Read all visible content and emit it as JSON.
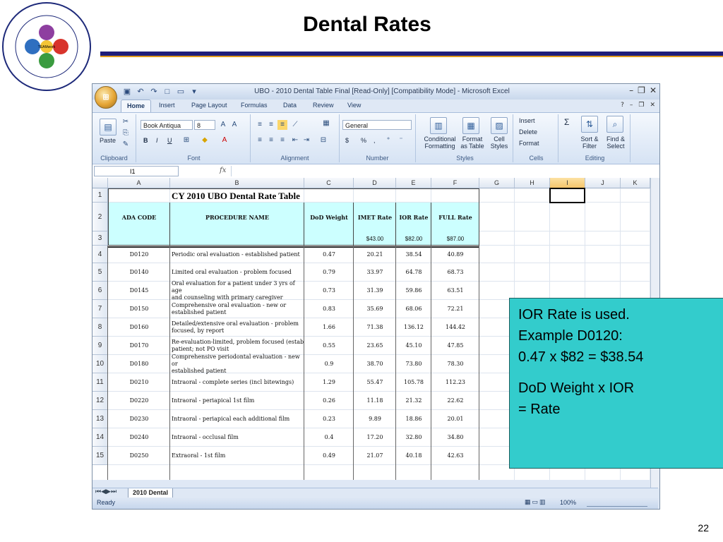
{
  "slide": {
    "title": "Dental Rates",
    "page_number": "22",
    "logo": {
      "ring_text": "2011 MHS REVENUE CYCLE EDUCATIONAL CONFERENCE",
      "bottom_text": "Together Everyone Achieves More",
      "labels": [
        "UBO",
        "TEAMwork",
        "UBU",
        "DQ",
        "MEPRS"
      ]
    }
  },
  "excel": {
    "window_title": "UBO - 2010 Dental Table Final  [Read-Only]  [Compatibility Mode] - Microsoft Excel",
    "tabs": [
      "Home",
      "Insert",
      "Page Layout",
      "Formulas",
      "Data",
      "Review",
      "View"
    ],
    "ribbon": {
      "clipboard": {
        "label": "Clipboard",
        "paste": "Paste"
      },
      "font": {
        "label": "Font",
        "family": "Book Antiqua",
        "size": "8",
        "bold": "B",
        "italic": "I",
        "underline": "U"
      },
      "alignment": {
        "label": "Alignment"
      },
      "number": {
        "label": "Number",
        "format": "General",
        "currency": "$",
        "percent": "%",
        "comma": ","
      },
      "styles": {
        "label": "Styles",
        "conditional": "Conditional Formatting",
        "format_table": "Format as Table",
        "cell_styles": "Cell Styles"
      },
      "cells": {
        "label": "Cells",
        "insert": "Insert",
        "delete": "Delete",
        "format": "Format"
      },
      "editing": {
        "label": "Editing",
        "sigma": "Σ",
        "sort": "Sort & Filter",
        "find": "Find & Select"
      }
    },
    "name_box": "I1",
    "fx": "fx",
    "columns": [
      "A",
      "B",
      "C",
      "D",
      "E",
      "F",
      "G",
      "H",
      "I",
      "J",
      "K"
    ],
    "selected_column": "I",
    "rows": [
      "1",
      "2",
      "3",
      "4",
      "5",
      "6",
      "7",
      "8",
      "9",
      "10",
      "11",
      "12",
      "13",
      "14",
      "15"
    ],
    "sheet": {
      "title": "CY 2010 UBO Dental Rate Table",
      "headers": [
        "ADA CODE",
        "PROCEDURE NAME",
        "DoD Weight",
        "IMET Rate",
        "IOR Rate",
        "FULL Rate"
      ],
      "base_rates": {
        "imet": "$43.00",
        "ior": "$82.00",
        "full": "$87.00"
      },
      "data": [
        {
          "code": "D0120",
          "name": [
            "Periodic oral evaluation - established patient"
          ],
          "weight": "0.47",
          "imet": "20.21",
          "ior": "38.54",
          "full": "40.89"
        },
        {
          "code": "D0140",
          "name": [
            "Limited oral evaluation - problem focused"
          ],
          "weight": "0.79",
          "imet": "33.97",
          "ior": "64.78",
          "full": "68.73"
        },
        {
          "code": "D0145",
          "name": [
            "Oral evaluation for a patient under 3 yrs of age",
            "and counseling with primary caregiver"
          ],
          "weight": "0.73",
          "imet": "31.39",
          "ior": "59.86",
          "full": "63.51"
        },
        {
          "code": "D0150",
          "name": [
            "Comprehensive oral evaluation - new or",
            "established patient"
          ],
          "weight": "0.83",
          "imet": "35.69",
          "ior": "68.06",
          "full": "72.21"
        },
        {
          "code": "D0160",
          "name": [
            "Detailed/extensive oral evaluation - problem",
            "focused, by report"
          ],
          "weight": "1.66",
          "imet": "71.38",
          "ior": "136.12",
          "full": "144.42"
        },
        {
          "code": "D0170",
          "name": [
            "Re-evaluation-limited, problem focused (estab",
            "patient; not PO visit"
          ],
          "weight": "0.55",
          "imet": "23.65",
          "ior": "45.10",
          "full": "47.85"
        },
        {
          "code": "D0180",
          "name": [
            "Comprehensive periodontal evaluation - new or",
            "established patient"
          ],
          "weight": "0.9",
          "imet": "38.70",
          "ior": "73.80",
          "full": "78.30"
        },
        {
          "code": "D0210",
          "name": [
            "Intraoral - complete series (incl bitewings)"
          ],
          "weight": "1.29",
          "imet": "55.47",
          "ior": "105.78",
          "full": "112.23"
        },
        {
          "code": "D0220",
          "name": [
            "Intraoral - periapical 1st film"
          ],
          "weight": "0.26",
          "imet": "11.18",
          "ior": "21.32",
          "full": "22.62"
        },
        {
          "code": "D0230",
          "name": [
            "Intraoral - periapical each additional film"
          ],
          "weight": "0.23",
          "imet": "9.89",
          "ior": "18.86",
          "full": "20.01"
        },
        {
          "code": "D0240",
          "name": [
            "Intraoral - occlusal film"
          ],
          "weight": "0.4",
          "imet": "17.20",
          "ior": "32.80",
          "full": "34.80"
        },
        {
          "code": "D0250",
          "name": [
            "Extraoral - 1st film"
          ],
          "weight": "0.49",
          "imet": "21.07",
          "ior": "40.18",
          "full": "42.63"
        }
      ]
    },
    "sheet_tab": "2010 Dental",
    "status": "Ready",
    "zoom": "100%"
  },
  "callout": {
    "line1": "IOR Rate is used.",
    "line2": "Example D0120:",
    "line3": "0.47 x $82 = $38.54",
    "line4": "DoD Weight x IOR",
    "line5": "= Rate"
  }
}
